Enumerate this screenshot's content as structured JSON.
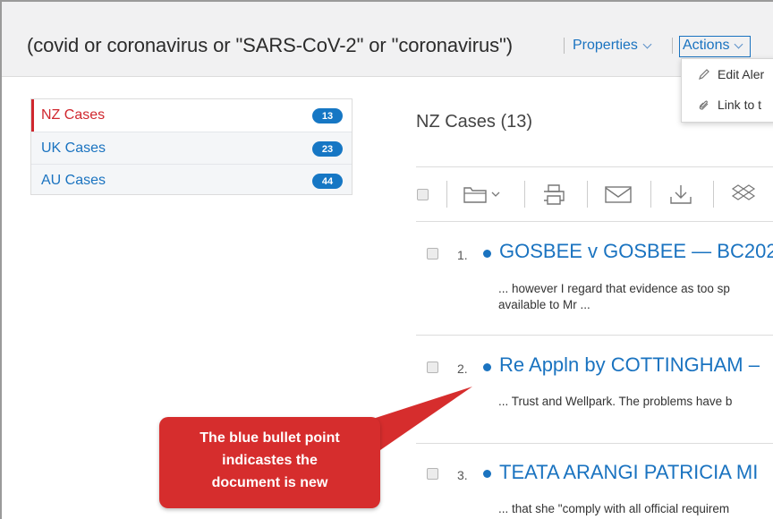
{
  "header": {
    "query": "(covid or coronavirus or \"SARS-CoV-2\" or \"coronavirus\")",
    "properties_label": "Properties",
    "actions_label": "Actions"
  },
  "actions_menu": {
    "items": [
      {
        "label": "Edit Aler",
        "icon": "pencil-icon"
      },
      {
        "label": "Link to t",
        "icon": "paperclip-icon"
      }
    ]
  },
  "sidebar": {
    "items": [
      {
        "label": "NZ Cases",
        "count": "13",
        "active": true
      },
      {
        "label": "UK Cases",
        "count": "23",
        "active": false
      },
      {
        "label": "AU Cases",
        "count": "44",
        "active": false
      }
    ]
  },
  "results": {
    "title": "NZ Cases (13)",
    "toolbar_icons": [
      "select-all-checkbox",
      "folder-icon",
      "print-icon",
      "email-icon",
      "download-icon",
      "dropbox-icon"
    ],
    "items": [
      {
        "num": "1.",
        "title": "GOSBEE v GOSBEE — BC202",
        "snippet_lines": [
          "... however I regard that evidence as too sp",
          "available to Mr ..."
        ],
        "is_new": true
      },
      {
        "num": "2.",
        "title": "Re Appln by COTTINGHAM –",
        "snippet_lines": [
          "... Trust and Wellpark. The problems have b"
        ],
        "is_new": true
      },
      {
        "num": "3.",
        "title": "TEATA ARANGI PATRICIA MI",
        "snippet_lines": [
          "... that she \"comply with all official requirem"
        ],
        "is_new": true
      }
    ]
  },
  "callout": {
    "lines": [
      "The blue bullet point",
      "indicastes the",
      "document is new"
    ]
  },
  "colors": {
    "link_blue": "#1a73c0",
    "active_red": "#d0272e",
    "badge_blue": "#1677c4",
    "callout_red": "#d62d2d"
  }
}
